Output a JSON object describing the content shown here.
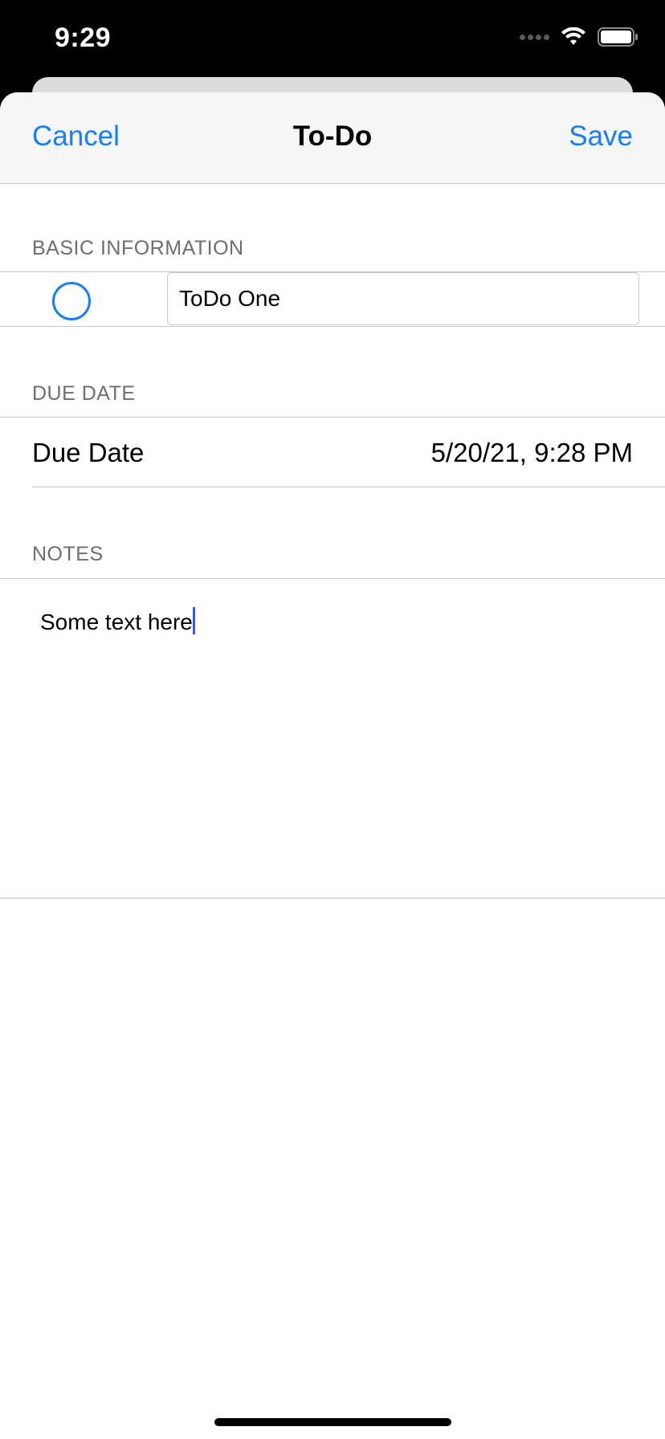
{
  "status_bar": {
    "time": "9:29",
    "icons": [
      "cellular-signal-icon",
      "wifi-icon",
      "battery-icon"
    ]
  },
  "navbar": {
    "cancel_label": "Cancel",
    "title": "To-Do",
    "save_label": "Save"
  },
  "sections": {
    "basic_header": "BASIC INFORMATION",
    "due_header": "DUE DATE",
    "notes_header": "NOTES"
  },
  "basic": {
    "title_value": "ToDo One",
    "complete_icon": "circle-outline-icon"
  },
  "due": {
    "label": "Due Date",
    "value": "5/20/21, 9:28 PM"
  },
  "notes": {
    "text": "Some text here"
  },
  "colors": {
    "accent": "#157efb",
    "separator": "#c8c7cc",
    "section_text": "#6d6d72",
    "navbar_bg": "#f6f6f6"
  }
}
